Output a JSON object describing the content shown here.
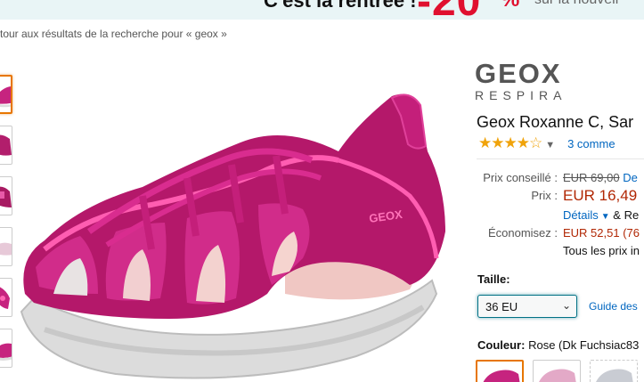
{
  "promo": {
    "text": "C'est la rentrée !",
    "discount_number": "-20",
    "discount_pct": "%",
    "subtext": "sur la nouvell"
  },
  "breadcrumb": {
    "text": "tour aux résultats de la recherche pour « geox »"
  },
  "brand": {
    "logo_main": "GEOX",
    "logo_sub": "RESPIRA"
  },
  "product": {
    "title": "Geox Roxanne C, Sar",
    "stars": "★★★★☆",
    "reviews": "3 comme"
  },
  "price": {
    "list_label": "Prix conseillé :",
    "list_value": "EUR 69,00",
    "list_extra": "De",
    "price_label": "Prix :",
    "price_value": "EUR 16,49",
    "details": "Détails",
    "details_after": "& Re",
    "save_label": "Économisez :",
    "save_value": "EUR 52,51 (76",
    "tax_note": "Tous les prix in"
  },
  "size": {
    "label": "Taille:",
    "selected": "36 EU",
    "guide": "Guide des"
  },
  "color": {
    "label": "Couleur:",
    "value": "Rose (Dk Fuchsiac83"
  },
  "colors": {
    "accent": "#e77600",
    "link": "#0066c0",
    "price": "#b12704",
    "promo_red": "#e0102f"
  }
}
